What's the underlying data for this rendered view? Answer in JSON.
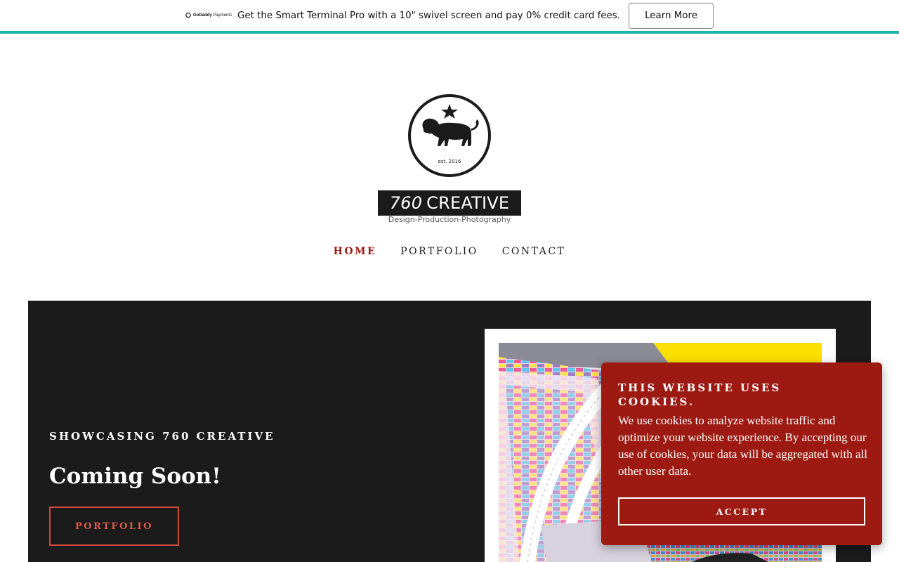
{
  "promo": {
    "brand_strong": "GoDaddy",
    "brand_light": "Payments",
    "text": "Get the Smart Terminal Pro with a 10\" swivel screen and pay 0% credit card fees.",
    "button_label": "Learn More",
    "accent_color": "#1bb3a8"
  },
  "logo": {
    "name_number": "760",
    "name_word": "CREATIVE",
    "tagline": "Design-Production-Photography",
    "badge_text": "est. 2016"
  },
  "nav": {
    "items": [
      {
        "label": "HOME",
        "active": true
      },
      {
        "label": "PORTFOLIO",
        "active": false
      },
      {
        "label": "CONTACT",
        "active": false
      }
    ],
    "active_color": "#9b1b14"
  },
  "hero": {
    "eyebrow": "SHOWCASING 760 CREATIVE",
    "title": "Coming Soon!",
    "button_label": "PORTFOLIO",
    "image_icon": "color-swatch-chart-photo"
  },
  "cookie": {
    "title": "THIS WEBSITE USES COOKIES.",
    "body": "We use cookies to analyze website traffic and optimize your website experience. By accepting our use of cookies, your data will be aggregated with all other user data.",
    "button_label": "ACCEPT",
    "background_color": "#9d1a12"
  }
}
